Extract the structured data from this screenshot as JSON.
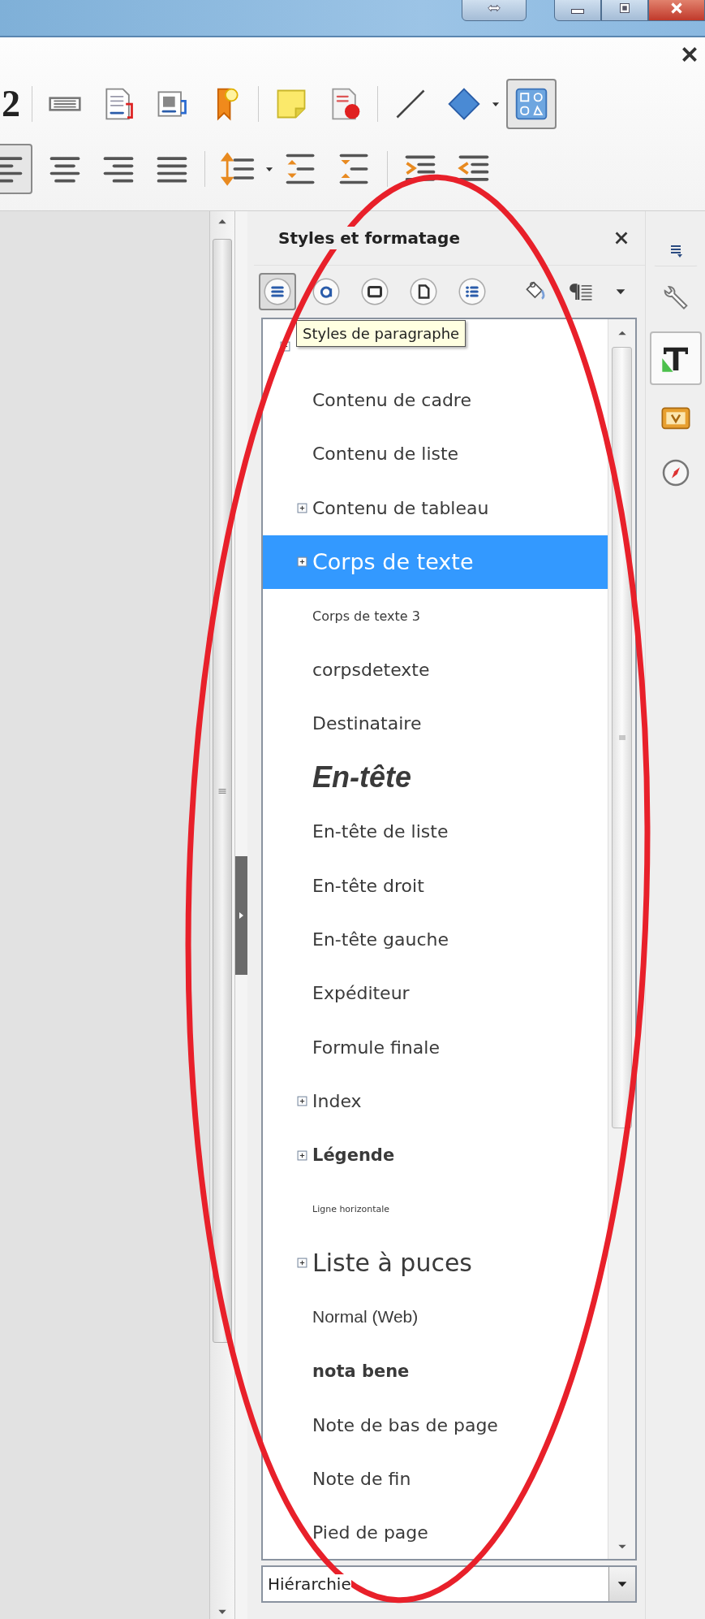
{
  "toolbar": {
    "rows": [
      [
        {
          "kind": "numbering",
          "label": "2"
        },
        {
          "kind": "sep"
        },
        {
          "kind": "field",
          "selected": false
        },
        {
          "kind": "crossref",
          "selected": false
        },
        {
          "kind": "caption",
          "selected": false
        },
        {
          "kind": "bookmark",
          "selected": false
        },
        {
          "kind": "sep"
        },
        {
          "kind": "note",
          "selected": false
        },
        {
          "kind": "tracked",
          "selected": false
        },
        {
          "kind": "sep"
        },
        {
          "kind": "line",
          "selected": false
        },
        {
          "kind": "diamond",
          "selected": false
        },
        {
          "kind": "caret"
        },
        {
          "kind": "shapes",
          "selected": true
        }
      ],
      [
        {
          "kind": "align-left",
          "selected": true
        },
        {
          "kind": "align-center",
          "selected": false
        },
        {
          "kind": "align-right",
          "selected": false
        },
        {
          "kind": "justify",
          "selected": false
        },
        {
          "kind": "sep"
        },
        {
          "kind": "line-spacing",
          "selected": false
        },
        {
          "kind": "caret"
        },
        {
          "kind": "para-more",
          "selected": false
        },
        {
          "kind": "para-less",
          "selected": false
        },
        {
          "kind": "sep"
        },
        {
          "kind": "indent-more",
          "selected": false
        },
        {
          "kind": "indent-less",
          "selected": false
        }
      ]
    ]
  },
  "panel": {
    "title": "Styles et formatage",
    "families": [
      {
        "kind": "paragraph",
        "selected": true
      },
      {
        "kind": "character",
        "selected": false
      },
      {
        "kind": "frame",
        "selected": false
      },
      {
        "kind": "page",
        "selected": false
      },
      {
        "kind": "list",
        "selected": false
      }
    ],
    "tooltip": "Styles de paragraphe",
    "styles": [
      {
        "expanded": true,
        "selected": false,
        "children": [
          {
            "kind": "normal",
            "label": "Contenu de cadre",
            "selected": false
          },
          {
            "kind": "normal",
            "label": "Contenu de liste",
            "selected": false
          },
          {
            "kind": "normal",
            "expanded": false,
            "label": "Contenu de tableau",
            "selected": false
          },
          {
            "kind": "large",
            "expanded": false,
            "label": "Corps de texte",
            "selected": true
          },
          {
            "kind": "small",
            "label": "Corps de texte 3",
            "selected": false
          },
          {
            "kind": "normal",
            "label": "corpsdetexte",
            "selected": false
          },
          {
            "kind": "normal",
            "label": "Destinataire",
            "selected": false
          },
          {
            "kind": "heading",
            "label": "En-tête",
            "selected": false
          },
          {
            "kind": "normal",
            "label": "En-tête de liste",
            "selected": false
          },
          {
            "kind": "normal",
            "label": "En-tête droit",
            "selected": false
          },
          {
            "kind": "normal",
            "label": "En-tête gauche",
            "selected": false
          },
          {
            "kind": "normal",
            "label": "Expéditeur",
            "selected": false
          },
          {
            "kind": "normal",
            "label": "Formule finale",
            "selected": false
          },
          {
            "kind": "normal",
            "expanded": false,
            "label": "Index",
            "selected": false
          },
          {
            "kind": "bold",
            "expanded": false,
            "label": "Légende",
            "selected": false
          },
          {
            "kind": "tiny",
            "label": "Ligne horizontale",
            "selected": false
          },
          {
            "kind": "xlarge",
            "expanded": false,
            "label": "Liste à puces",
            "selected": false
          },
          {
            "kind": "web",
            "label": "Normal (Web)",
            "selected": false
          },
          {
            "kind": "bold",
            "label": "nota bene",
            "selected": false
          },
          {
            "kind": "normal",
            "label": "Note de bas de page",
            "selected": false
          },
          {
            "kind": "normal",
            "label": "Note de fin",
            "selected": false
          },
          {
            "kind": "normal",
            "label": "Pied de page",
            "selected": false
          }
        ]
      }
    ],
    "filter": "Hiérarchie"
  },
  "sidebar": [
    {
      "kind": "menu",
      "selected": false
    },
    {
      "kind": "properties",
      "selected": false
    },
    {
      "kind": "styles",
      "selected": true
    },
    {
      "kind": "gallery",
      "selected": false
    },
    {
      "kind": "navigator",
      "selected": false
    }
  ]
}
